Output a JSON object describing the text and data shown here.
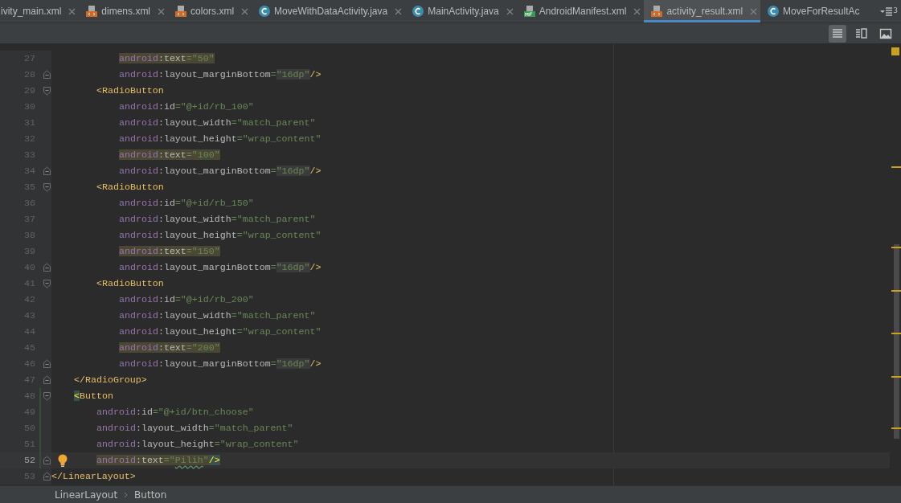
{
  "tabs": [
    {
      "label": "ivity_main.xml",
      "kind": "cut",
      "selected": false,
      "closable": true
    },
    {
      "label": "dimens.xml",
      "kind": "xml",
      "selected": false,
      "closable": true
    },
    {
      "label": "colors.xml",
      "kind": "xml",
      "selected": false,
      "closable": true
    },
    {
      "label": "MoveWithDataActivity.java",
      "kind": "java",
      "selected": false,
      "closable": true
    },
    {
      "label": "MainActivity.java",
      "kind": "java",
      "selected": false,
      "closable": true
    },
    {
      "label": "AndroidManifest.xml",
      "kind": "manifest",
      "selected": false,
      "closable": true
    },
    {
      "label": "activity_result.xml",
      "kind": "xml",
      "selected": true,
      "closable": true
    },
    {
      "label": "MoveForResultAc",
      "kind": "java",
      "selected": false,
      "closable": false
    }
  ],
  "hidden_tabs": {
    "count": "3"
  },
  "view_modes": [
    {
      "kind": "code",
      "selected": true
    },
    {
      "kind": "split",
      "selected": false
    },
    {
      "kind": "design",
      "selected": false
    }
  ],
  "lines": [
    {
      "children": [
        {
          "children": [
            {
              "children": [
                {
                  "n": "27",
                  "tokens": [
                    {
                      "kind": "ns",
                      "text": "android",
                      "matched": true
                    },
                    {
                      "kind": "attr",
                      "text": ":text",
                      "matched": true
                    },
                    {
                      "kind": "str",
                      "text": "=\"50\"",
                      "matched": true
                    }
                  ]
                },
                {
                  "n": "28",
                  "fold_end": true,
                  "tokens": [
                    {
                      "kind": "ns",
                      "text": "android"
                    },
                    {
                      "kind": "attr",
                      "text": ":layout_marginBottom"
                    },
                    {
                      "kind": "str",
                      "text": "="
                    },
                    {
                      "kind": "str",
                      "text": "\"16dp\"",
                      "boxed": true
                    },
                    {
                      "kind": "tag",
                      "text": "/>"
                    }
                  ]
                }
              ]
            },
            {
              "n": "29",
              "fold_start": true,
              "tokens": [
                {
                  "kind": "tag",
                  "text": "<RadioButton"
                }
              ],
              "children": [
                {
                  "n": "30",
                  "tokens": [
                    {
                      "kind": "ns",
                      "text": "android"
                    },
                    {
                      "kind": "attr",
                      "text": ":id"
                    },
                    {
                      "kind": "str",
                      "text": "=\"@+id/rb_100\""
                    }
                  ]
                },
                {
                  "n": "31",
                  "tokens": [
                    {
                      "kind": "ns",
                      "text": "android"
                    },
                    {
                      "kind": "attr",
                      "text": ":layout_width"
                    },
                    {
                      "kind": "str",
                      "text": "=\"match_parent\""
                    }
                  ]
                },
                {
                  "n": "32",
                  "tokens": [
                    {
                      "kind": "ns",
                      "text": "android"
                    },
                    {
                      "kind": "attr",
                      "text": ":layout_height"
                    },
                    {
                      "kind": "str",
                      "text": "=\"wrap_content\""
                    }
                  ]
                },
                {
                  "n": "33",
                  "tokens": [
                    {
                      "kind": "ns",
                      "text": "android",
                      "matched": true
                    },
                    {
                      "kind": "attr",
                      "text": ":text",
                      "matched": true
                    },
                    {
                      "kind": "str",
                      "text": "=\"100\"",
                      "matched": true
                    }
                  ]
                },
                {
                  "n": "34",
                  "fold_end": true,
                  "tokens": [
                    {
                      "kind": "ns",
                      "text": "android"
                    },
                    {
                      "kind": "attr",
                      "text": ":layout_marginBottom"
                    },
                    {
                      "kind": "str",
                      "text": "="
                    },
                    {
                      "kind": "str",
                      "text": "\"16dp\"",
                      "boxed": true
                    },
                    {
                      "kind": "tag",
                      "text": "/>"
                    }
                  ]
                }
              ]
            },
            {
              "n": "35",
              "fold_start": true,
              "tokens": [
                {
                  "kind": "tag",
                  "text": "<RadioButton"
                }
              ],
              "children": [
                {
                  "n": "36",
                  "tokens": [
                    {
                      "kind": "ns",
                      "text": "android"
                    },
                    {
                      "kind": "attr",
                      "text": ":id"
                    },
                    {
                      "kind": "str",
                      "text": "=\"@+id/rb_150\""
                    }
                  ]
                },
                {
                  "n": "37",
                  "tokens": [
                    {
                      "kind": "ns",
                      "text": "android"
                    },
                    {
                      "kind": "attr",
                      "text": ":layout_width"
                    },
                    {
                      "kind": "str",
                      "text": "=\"match_parent\""
                    }
                  ]
                },
                {
                  "n": "38",
                  "tokens": [
                    {
                      "kind": "ns",
                      "text": "android"
                    },
                    {
                      "kind": "attr",
                      "text": ":layout_height"
                    },
                    {
                      "kind": "str",
                      "text": "=\"wrap_content\""
                    }
                  ]
                },
                {
                  "n": "39",
                  "tokens": [
                    {
                      "kind": "ns",
                      "text": "android",
                      "matched": true
                    },
                    {
                      "kind": "attr",
                      "text": ":text",
                      "matched": true
                    },
                    {
                      "kind": "str",
                      "text": "=\"150\"",
                      "matched": true
                    }
                  ]
                },
                {
                  "n": "40",
                  "fold_end": true,
                  "tokens": [
                    {
                      "kind": "ns",
                      "text": "android"
                    },
                    {
                      "kind": "attr",
                      "text": ":layout_marginBottom"
                    },
                    {
                      "kind": "str",
                      "text": "="
                    },
                    {
                      "kind": "str",
                      "text": "\"16dp\"",
                      "boxed": true
                    },
                    {
                      "kind": "tag",
                      "text": "/>"
                    }
                  ]
                }
              ]
            },
            {
              "n": "41",
              "fold_start": true,
              "tokens": [
                {
                  "kind": "tag",
                  "text": "<RadioButton"
                }
              ],
              "children": [
                {
                  "n": "42",
                  "tokens": [
                    {
                      "kind": "ns",
                      "text": "android"
                    },
                    {
                      "kind": "attr",
                      "text": ":id"
                    },
                    {
                      "kind": "str",
                      "text": "=\"@+id/rb_200\""
                    }
                  ]
                },
                {
                  "n": "43",
                  "tokens": [
                    {
                      "kind": "ns",
                      "text": "android"
                    },
                    {
                      "kind": "attr",
                      "text": ":layout_width"
                    },
                    {
                      "kind": "str",
                      "text": "=\"match_parent\""
                    }
                  ]
                },
                {
                  "n": "44",
                  "tokens": [
                    {
                      "kind": "ns",
                      "text": "android"
                    },
                    {
                      "kind": "attr",
                      "text": ":layout_height"
                    },
                    {
                      "kind": "str",
                      "text": "=\"wrap_content\""
                    }
                  ]
                },
                {
                  "n": "45",
                  "tokens": [
                    {
                      "kind": "ns",
                      "text": "android",
                      "matched": true
                    },
                    {
                      "kind": "attr",
                      "text": ":text",
                      "matched": true
                    },
                    {
                      "kind": "str",
                      "text": "=\"200\"",
                      "matched": true
                    }
                  ]
                },
                {
                  "n": "46",
                  "fold_end": true,
                  "tokens": [
                    {
                      "kind": "ns",
                      "text": "android"
                    },
                    {
                      "kind": "attr",
                      "text": ":layout_marginBottom"
                    },
                    {
                      "kind": "str",
                      "text": "="
                    },
                    {
                      "kind": "str",
                      "text": "\"16dp\"",
                      "boxed": true
                    },
                    {
                      "kind": "tag",
                      "text": "/>"
                    }
                  ]
                }
              ]
            }
          ]
        },
        {
          "n": "47",
          "fold_end": true,
          "tokens": [
            {
              "kind": "tag",
              "text": "</RadioGroup>"
            }
          ]
        },
        {
          "n": "48",
          "fold_start": true,
          "changed": true,
          "tokens": [
            {
              "kind": "tag",
              "text": "<",
              "brace": true
            },
            {
              "kind": "tag",
              "text": "Button"
            }
          ],
          "children": [
            {
              "n": "49",
              "changed": true,
              "tokens": [
                {
                  "kind": "ns",
                  "text": "android"
                },
                {
                  "kind": "attr",
                  "text": ":id"
                },
                {
                  "kind": "str",
                  "text": "=\"@+id/btn_choose\""
                }
              ]
            },
            {
              "n": "50",
              "changed": true,
              "tokens": [
                {
                  "kind": "ns",
                  "text": "android"
                },
                {
                  "kind": "attr",
                  "text": ":layout_width"
                },
                {
                  "kind": "str",
                  "text": "=\"match_parent\""
                }
              ]
            },
            {
              "n": "51",
              "changed": true,
              "tokens": [
                {
                  "kind": "ns",
                  "text": "android"
                },
                {
                  "kind": "attr",
                  "text": ":layout_height"
                },
                {
                  "kind": "str",
                  "text": "=\"wrap_content\""
                }
              ]
            },
            {
              "n": "52",
              "fold_end": true,
              "changed": true,
              "current": true,
              "bulb": true,
              "tokens": [
                {
                  "kind": "ns",
                  "text": "android",
                  "matched": true
                },
                {
                  "kind": "attr",
                  "text": ":text",
                  "matched": true
                },
                {
                  "kind": "str",
                  "text": "=\"",
                  "matched": true
                },
                {
                  "kind": "str",
                  "text": "Pilih",
                  "matched": true,
                  "typo": true
                },
                {
                  "kind": "str",
                  "text": "\"",
                  "matched": true
                },
                {
                  "kind": "tag",
                  "text": "/>",
                  "brace": true
                }
              ]
            }
          ]
        }
      ]
    },
    {
      "n": "53",
      "fold_end": true,
      "tokens": [
        {
          "kind": "tag",
          "text": "</LinearLayout>"
        }
      ]
    }
  ],
  "breadcrumbs": [
    "LinearLayout",
    "Button"
  ]
}
